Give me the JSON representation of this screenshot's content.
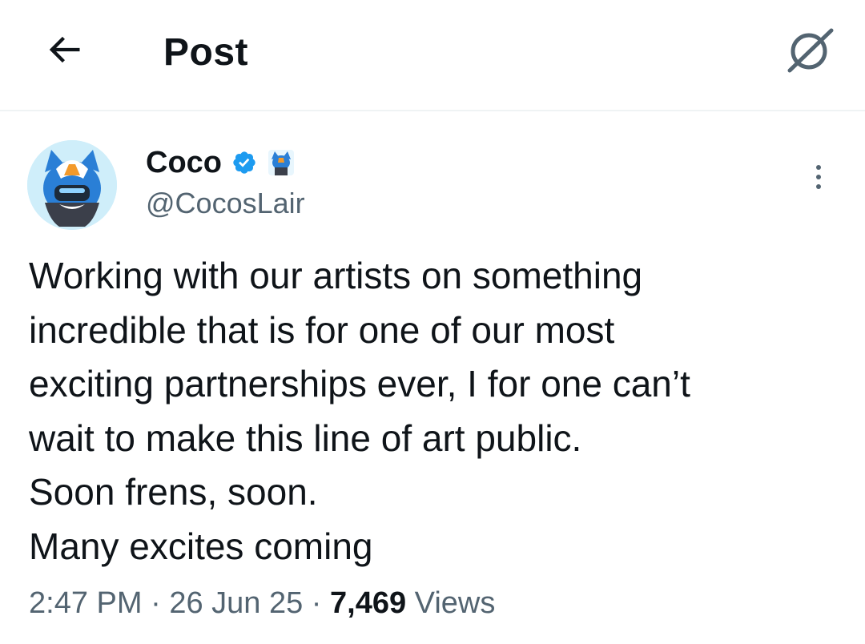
{
  "header": {
    "title": "Post",
    "back_icon": "arrow-left-icon",
    "action_icon": "spoiler-icon"
  },
  "post": {
    "author": {
      "display_name": "Coco",
      "handle": "@CocosLair",
      "verified": true,
      "verified_color": "#1d9bf0"
    },
    "text_lines": [
      "Working with our artists on something",
      "incredible that is for one of our most",
      "exciting partnerships ever, I for one can’t",
      "wait to make this line of art public.",
      "Soon frens, soon.",
      "Many excites coming"
    ],
    "meta": {
      "time": "2:47 PM",
      "separator": "·",
      "date": "26 Jun 25",
      "views_count": "7,469",
      "views_label": "Views"
    }
  },
  "colors": {
    "primary_text": "#0f1419",
    "secondary_text": "#536471",
    "accent": "#1d9bf0",
    "divider": "#eff3f4"
  }
}
